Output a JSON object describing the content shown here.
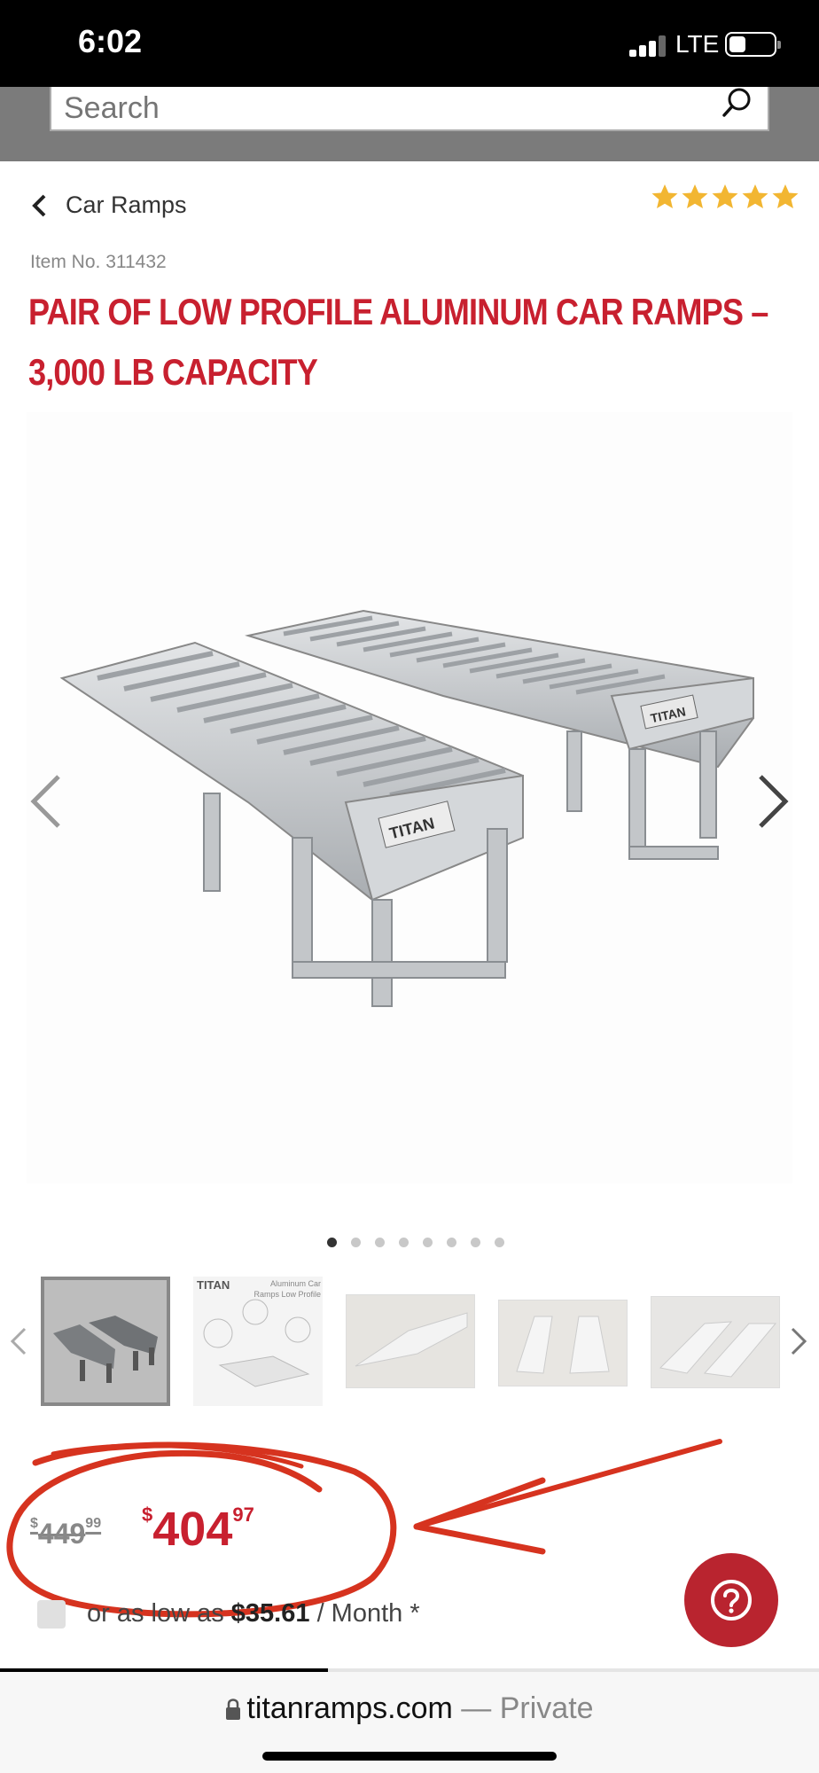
{
  "status": {
    "time": "6:02",
    "network": "LTE",
    "signal_bars": 3,
    "battery_level": 0.3
  },
  "search": {
    "placeholder": "Search"
  },
  "breadcrumb": {
    "label": "Car Ramps"
  },
  "rating": {
    "stars": 5
  },
  "product": {
    "item_no": "Item No. 311432",
    "title": "PAIR OF LOW PROFILE ALUMINUM CAR RAMPS – 3,000 LB CAPACITY"
  },
  "gallery": {
    "image_count": 8,
    "active_index": 0,
    "logo_text": "TITAN",
    "thumbs": [
      {
        "label": ""
      },
      {
        "label": "TITAN",
        "sub": "Aluminum Car Ramps Low Profile"
      },
      {
        "label": ""
      },
      {
        "label": ""
      },
      {
        "label": ""
      }
    ]
  },
  "price": {
    "old_currency": "$",
    "old_whole": "449",
    "old_cents": "99",
    "new_currency": "$",
    "new_whole": "404",
    "new_cents": "97"
  },
  "financing": {
    "prefix": "or as low as",
    "amount": "$35.61",
    "suffix": "/ Month *"
  },
  "browser": {
    "domain": "titanramps.com",
    "separator": "—",
    "mode": "Private",
    "load_progress": 0.4
  },
  "colors": {
    "brand_red": "#c8202f",
    "annotation_red": "#d6331f",
    "star_gold": "#f2b632"
  }
}
